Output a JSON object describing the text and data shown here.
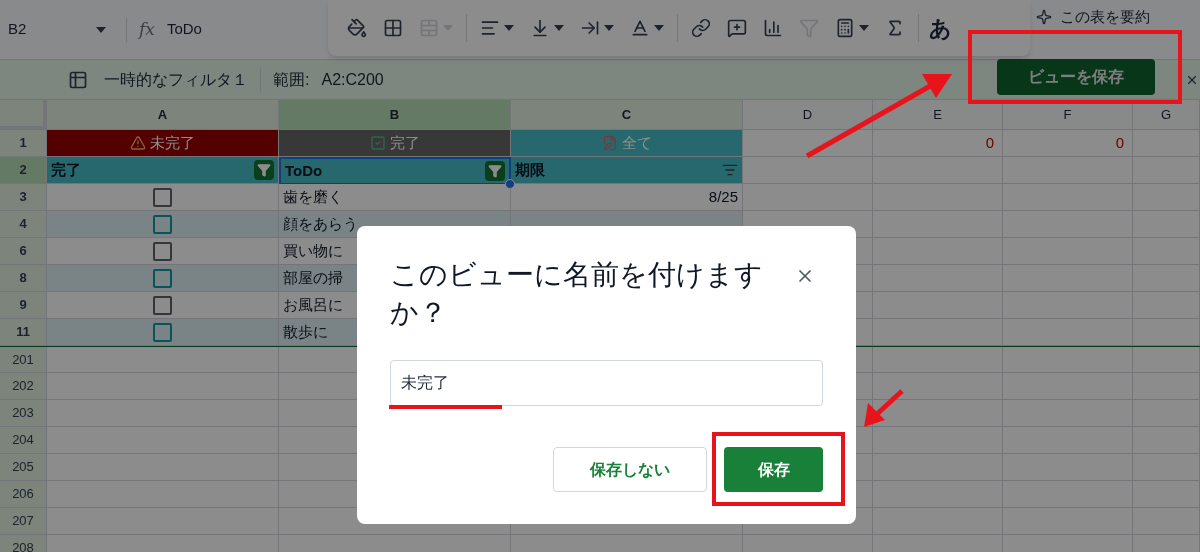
{
  "formula_bar": {
    "cell_ref": "B2",
    "function_symbol": "fx",
    "formula": "ToDo"
  },
  "toolbar": {
    "tools": [
      {
        "disabled": false,
        "menu": false
      },
      {
        "disabled": false,
        "menu": false
      },
      {
        "disabled": true,
        "menu": true
      },
      {
        "disabled": false,
        "menu": true
      },
      {
        "disabled": false,
        "menu": true
      },
      {
        "disabled": false,
        "menu": true
      },
      {
        "disabled": false,
        "menu": true
      },
      {
        "disabled": false,
        "menu": false
      },
      {
        "disabled": false,
        "menu": false
      },
      {
        "disabled": false,
        "menu": false
      },
      {
        "disabled": true,
        "menu": false
      },
      {
        "disabled": false,
        "menu": true
      },
      {
        "disabled": false,
        "menu": false
      }
    ],
    "input_tool": "あ",
    "summarize": "この表を要約"
  },
  "filter_bar": {
    "name": "一時的なフィルタ１",
    "range_label": "範囲:",
    "range": "A2:C200",
    "save_button": "ビューを保存"
  },
  "columns": [
    {
      "label": "A",
      "selected": false
    },
    {
      "label": "B",
      "selected": true
    },
    {
      "label": "C",
      "selected": false
    },
    {
      "label": "D",
      "selected": false
    },
    {
      "label": "E",
      "selected": false
    },
    {
      "label": "F",
      "selected": false
    },
    {
      "label": "G",
      "selected": false
    }
  ],
  "banner_row": {
    "number": "1",
    "cells": [
      {
        "text": "未完了",
        "kind": "incomplete"
      },
      {
        "text": "完了",
        "kind": "complete"
      },
      {
        "text": "全て",
        "kind": "all"
      }
    ],
    "extra_cells": [
      "0",
      "0"
    ]
  },
  "header_row": {
    "number": "2",
    "selected": true,
    "cells": [
      {
        "text": "完了",
        "selected": false,
        "filtered": true
      },
      {
        "text": "ToDo",
        "selected": true,
        "filtered": true
      },
      {
        "text": "期限",
        "selected": false,
        "filtered": false
      }
    ]
  },
  "task_rows": [
    {
      "number": "3",
      "checked": false,
      "banded": false,
      "todo": "歯を磨く",
      "due": "8/25"
    },
    {
      "number": "4",
      "checked": false,
      "banded": true,
      "todo": "顔をあらう"
    },
    {
      "number": "6",
      "checked": false,
      "banded": false,
      "todo": "買い物に"
    },
    {
      "number": "8",
      "checked": false,
      "banded": true,
      "todo": "部屋の掃"
    },
    {
      "number": "9",
      "checked": false,
      "banded": false,
      "todo": "お風呂に"
    },
    {
      "number": "11",
      "checked": false,
      "banded": true,
      "todo": "散歩に"
    }
  ],
  "empty_rows": [
    "201",
    "202",
    "203",
    "204",
    "205",
    "206",
    "207",
    "208"
  ],
  "dialog": {
    "title": "このビューに名前を付けますか？",
    "value": "未完了",
    "buttons": [
      {
        "label": "保存しない",
        "kind": "secondary"
      },
      {
        "label": "保存",
        "kind": "primary"
      }
    ]
  }
}
